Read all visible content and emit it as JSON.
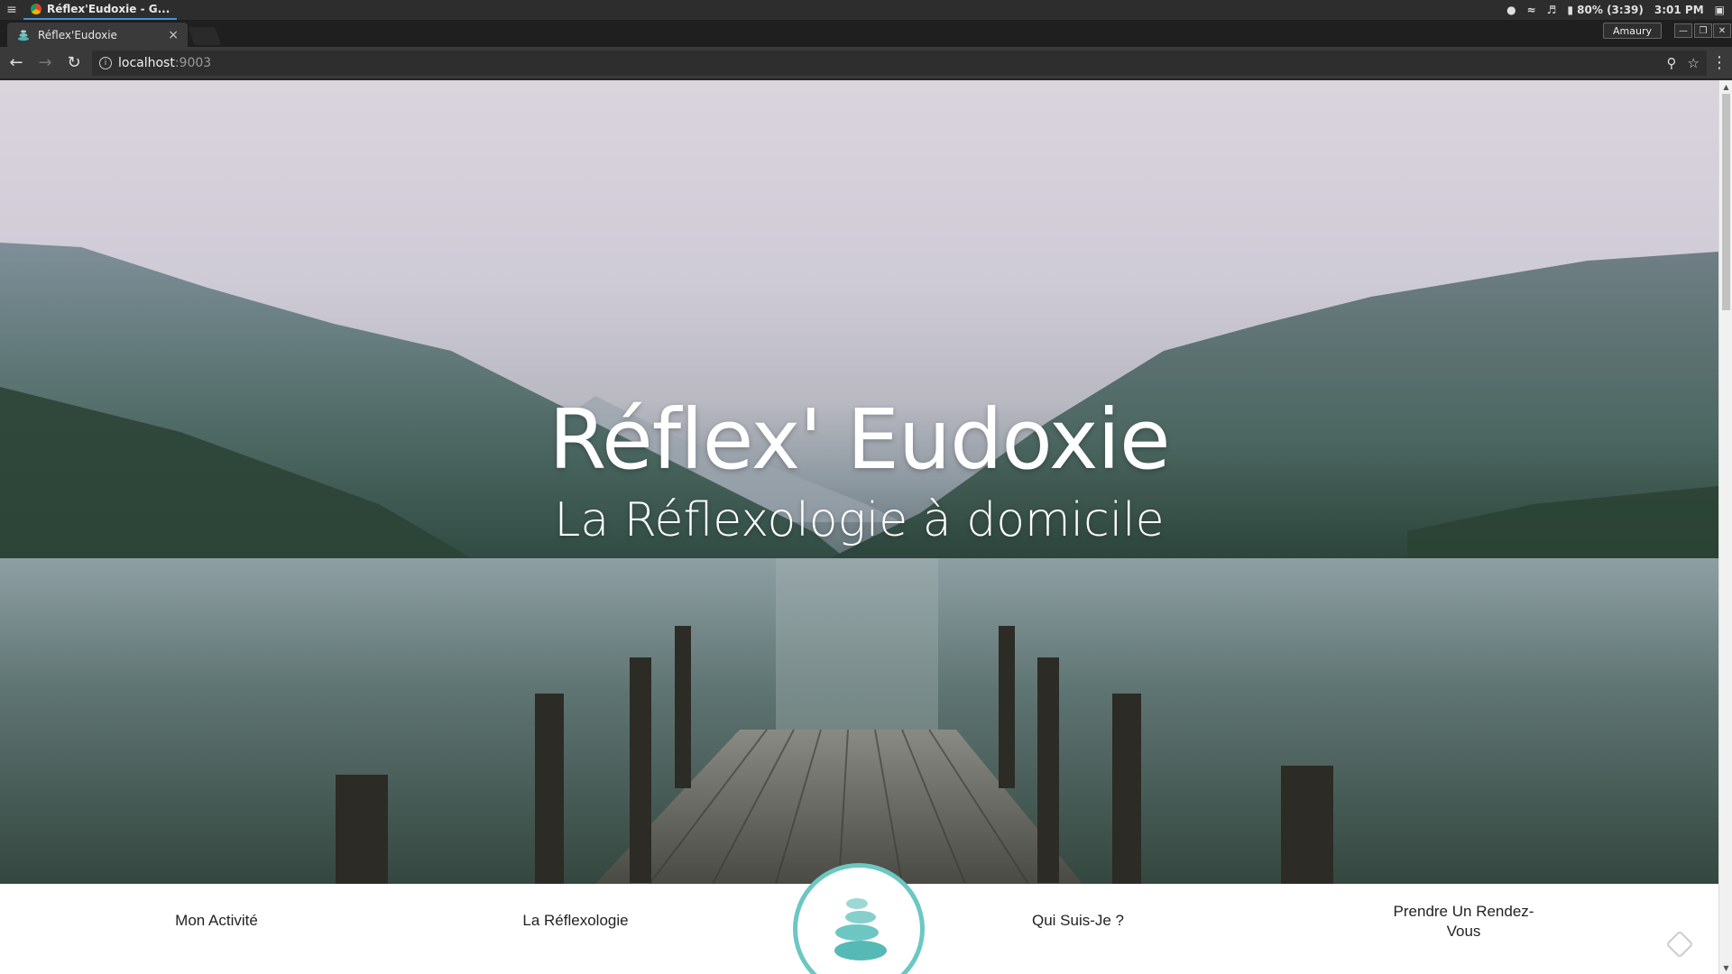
{
  "os": {
    "window_title": "Réflex'Eudoxie - G...",
    "battery": "80% (3:39)",
    "time": "3:01 PM"
  },
  "browser": {
    "tab_title": "Réflex'Eudoxie",
    "profile_name": "Amaury",
    "url_host": "localhost",
    "url_port": ":9003"
  },
  "hero": {
    "title": "Réflex' Eudoxie",
    "subtitle": "La Réflexologie à domicile"
  },
  "nav": {
    "items": [
      {
        "label": "Mon Activité"
      },
      {
        "label": "La Réflexologie"
      },
      {
        "label": "Qui Suis-Je ?"
      },
      {
        "label": "Prendre Un Rendez-Vous"
      }
    ]
  },
  "colors": {
    "accent": "#6cc7c3"
  }
}
